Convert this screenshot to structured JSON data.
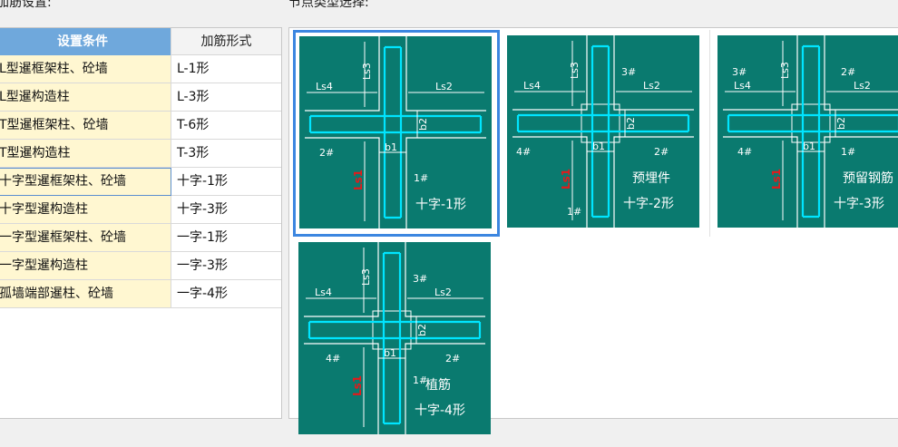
{
  "left_title": "加筋设置:",
  "right_title": "节点类型选择:",
  "table": {
    "headers": [
      "设置条件",
      "加筋形式"
    ],
    "rows": [
      {
        "condition": "L型暹框架柱、砼墙",
        "form": "L-1形"
      },
      {
        "condition": "L型暹构造柱",
        "form": "L-3形"
      },
      {
        "condition": "T型暹框架柱、砼墙",
        "form": "T-6形"
      },
      {
        "condition": "T型暹构造柱",
        "form": "T-3形"
      },
      {
        "condition": "十字型暹框架柱、砼墙",
        "form": "十字-1形"
      },
      {
        "condition": "十字型暹构造柱",
        "form": "十字-3形"
      },
      {
        "condition": "一字型暹框架柱、砼墙",
        "form": "一字-1形"
      },
      {
        "condition": "一字型暹构造柱",
        "form": "一字-3形"
      },
      {
        "condition": "孤墙端部暹柱、砼墙",
        "form": "一字-4形"
      }
    ],
    "selected_row": 4
  },
  "nodes": [
    {
      "caption": "十字-1形",
      "note": "",
      "marks": [
        "2#",
        "1#"
      ],
      "selected": true
    },
    {
      "caption": "十字-2形",
      "note": "预埋件",
      "marks": [
        "3#",
        "4#",
        "2#",
        "1#"
      ],
      "selected": false
    },
    {
      "caption": "十字-3形",
      "note": "预留钢筋",
      "marks": [
        "3#",
        "2#",
        "4#",
        "1#"
      ],
      "selected": false
    },
    {
      "caption": "十字-4形",
      "note": "植筋",
      "marks": [
        "3#",
        "4#",
        "2#",
        "1#"
      ],
      "selected": false
    }
  ],
  "dims": {
    "ls1": "Ls1",
    "ls2": "Ls2",
    "ls3": "Ls3",
    "ls4": "Ls4",
    "b1": "b1",
    "b2": "b2"
  },
  "colors": {
    "panel_bg": "#0a7a6f",
    "rebar": "#00e5ff",
    "line": "#ffffff",
    "accent": "#e31a1a",
    "header_blue": "#6fa8dc",
    "row_yellow": "#fff7d1",
    "select_border": "#3c86e0"
  }
}
